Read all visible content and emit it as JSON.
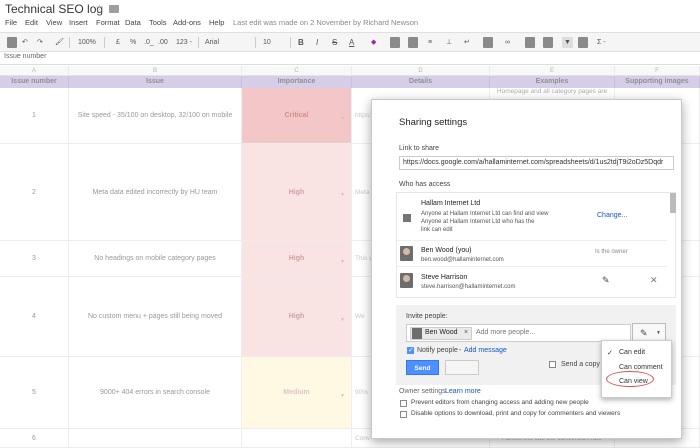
{
  "doc": {
    "title": "Technical SEO log",
    "last_edit": "Last edit was made on 2 November by Richard Newson"
  },
  "menu": [
    "File",
    "Edit",
    "View",
    "Insert",
    "Format",
    "Data",
    "Tools",
    "Add-ons",
    "Help"
  ],
  "toolbar": {
    "zoom": "100%",
    "currency": "£",
    "percent": "%",
    "dec_less": ".0_",
    "dec_more": ".00",
    "more_formats": "123 -",
    "font": "Arial",
    "font_size": "10",
    "bold": "B",
    "sum": "Σ -"
  },
  "formula": {
    "cell_ref": "Issue number"
  },
  "columns": [
    "A",
    "B",
    "C",
    "D",
    "E",
    "F"
  ],
  "headers": [
    "Issue number",
    "Issue",
    "Importance",
    "Details",
    "Examples",
    "Supporting images"
  ],
  "rows": [
    {
      "num": "1",
      "issue": "Site speed - 35/100 on desktop, 32/100 on mobile",
      "importance": "Critical",
      "details": "https://",
      "examples": "Homepage and all category pages are"
    },
    {
      "num": "2",
      "issue": "Meta data edited incorrectly by HU team",
      "importance": "High",
      "details": "Meta d",
      "examples": ""
    },
    {
      "num": "3",
      "issue": "No headings on mobile category pages",
      "importance": "High",
      "details": "This w",
      "examples": ""
    },
    {
      "num": "4",
      "issue": "No custom menu + pages still being moved",
      "importance": "High",
      "details": "We",
      "examples": ""
    },
    {
      "num": "5",
      "issue": "9000+ 404 errors in search console",
      "importance": "Medium",
      "details": "90%",
      "examples": ""
    },
    {
      "num": "6",
      "issue": "",
      "importance": "",
      "details": "Conv",
      "examples": "Across the site the conversion rate"
    }
  ],
  "dialog": {
    "title": "Sharing settings",
    "link_label": "Link to share",
    "link_value": "https://docs.google.com/a/hallaminternet.com/spreadsheets/d/1us2tdjT9i2oDz5Dqdr",
    "who_label": "Who has access",
    "org": {
      "name": "Hallam Internet Ltd",
      "line1": "Anyone at Hallam Internet Ltd can find and view",
      "line2": "Anyone at Hallam Internet Ltd who has the",
      "line3": "link can edit",
      "change": "Change..."
    },
    "people": [
      {
        "name": "Ben Wood (you)",
        "email": "ben.wood@hallaminternet.com",
        "role": "Is the owner"
      },
      {
        "name": "Steve Harrison",
        "email": "steve.harrison@hallaminternet.com"
      }
    ],
    "invite_label": "Invite people:",
    "chip_name": "Ben Wood",
    "invite_placeholder": "Add more people...",
    "notify_label": "Notify people",
    "add_message": "Add message",
    "send_copy": "Send a copy",
    "send": "Send",
    "owner_settings": "Owner settings",
    "learn_more": "Learn more",
    "opt1": "Prevent editors from changing access and adding new people",
    "opt2": "Disable options to download, print and copy for commenters and viewers"
  },
  "perm_menu": {
    "items": [
      "Can edit",
      "Can comment",
      "Can view"
    ],
    "checked": "Can edit",
    "highlighted": "Can view"
  }
}
